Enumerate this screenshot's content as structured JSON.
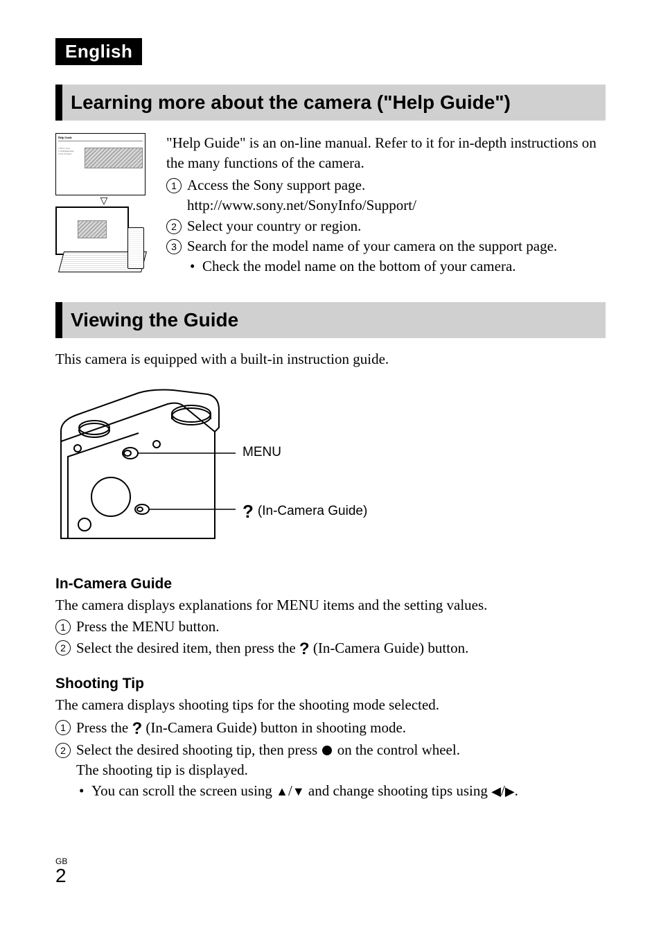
{
  "language_badge": "English",
  "section1": {
    "heading": "Learning more about the camera (\"Help Guide\")",
    "intro": "\"Help Guide\" is an on-line manual. Refer to it for in-depth instructions on the many functions of the camera.",
    "steps": [
      {
        "text": "Access the Sony support page.",
        "sub": "http://www.sony.net/SonyInfo/Support/"
      },
      {
        "text": "Select your country or region."
      },
      {
        "text": "Search for the model name of your camera on the support page.",
        "bulleted_sub": "Check the model name on the bottom of your camera."
      }
    ]
  },
  "section2": {
    "heading": "Viewing the Guide",
    "intro": "This camera is equipped with a built-in instruction guide.",
    "callouts": {
      "menu": "MENU",
      "guide": "(In-Camera Guide)"
    },
    "in_camera": {
      "title": "In-Camera Guide",
      "intro": "The camera displays explanations for MENU items and the setting values.",
      "steps": [
        "Press the MENU button.",
        "Select the desired item, then press the "
      ],
      "step2_suffix": " (In-Camera Guide) button."
    },
    "shooting_tip": {
      "title": "Shooting Tip",
      "intro": "The camera displays shooting tips for the shooting mode selected.",
      "step1_prefix": "Press the ",
      "step1_suffix": " (In-Camera Guide) button in shooting mode.",
      "step2_prefix": "Select the desired shooting tip, then press ",
      "step2_suffix": " on the control wheel.",
      "step2_line2": "The shooting tip is displayed.",
      "step2_bullet_prefix": "You can scroll the screen using ",
      "step2_bullet_middle": " and change shooting tips using ",
      "step2_bullet_suffix": "."
    }
  },
  "footer": {
    "region": "GB",
    "page": "2"
  }
}
